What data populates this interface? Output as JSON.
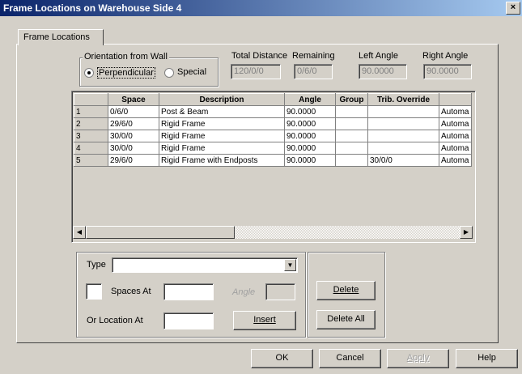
{
  "window": {
    "title": "Frame Locations on Warehouse Side 4",
    "close_glyph": "×"
  },
  "tab": {
    "label": "Frame Locations"
  },
  "orientation": {
    "group_label": "Orientation from Wall",
    "perpendicular": "Perpendicular",
    "special": "Special",
    "selected": "Perpendicular"
  },
  "summary": {
    "total_distance_label": "Total Distance",
    "total_distance_value": "120/0/0",
    "remaining_label": "Remaining",
    "remaining_value": "0/6/0",
    "left_angle_label": "Left Angle",
    "left_angle_value": "90.0000",
    "right_angle_label": "Right Angle",
    "right_angle_value": "90.0000"
  },
  "grid": {
    "columns": [
      "",
      "Space",
      "Description",
      "Angle",
      "Group",
      "Trib. Override",
      ""
    ],
    "rows": [
      [
        "1",
        "0/6/0",
        "Post & Beam",
        "90.0000",
        "",
        "",
        "Automa"
      ],
      [
        "2",
        "29/6/0",
        "Rigid Frame",
        "90.0000",
        "",
        "",
        "Automa"
      ],
      [
        "3",
        "30/0/0",
        "Rigid Frame",
        "90.0000",
        "",
        "",
        "Automa"
      ],
      [
        "4",
        "30/0/0",
        "Rigid Frame",
        "90.0000",
        "",
        "",
        "Automa"
      ],
      [
        "5",
        "29/6/0",
        "Rigid Frame with Endposts",
        "90.0000",
        "",
        "30/0/0",
        "Automa"
      ]
    ]
  },
  "form": {
    "type_label": "Type",
    "type_value": "",
    "spaces_at_label": "Spaces At",
    "spaces_at_value": "",
    "angle_label": "Angle",
    "angle_value": "",
    "or_location_label": "Or Location At",
    "or_location_value": "",
    "insert_label": "Insert",
    "delete_label": "Delete",
    "delete_all_label": "Delete All"
  },
  "footer": {
    "ok_label": "OK",
    "cancel_label": "Cancel",
    "apply_label": "Apply",
    "help_label": "Help"
  }
}
